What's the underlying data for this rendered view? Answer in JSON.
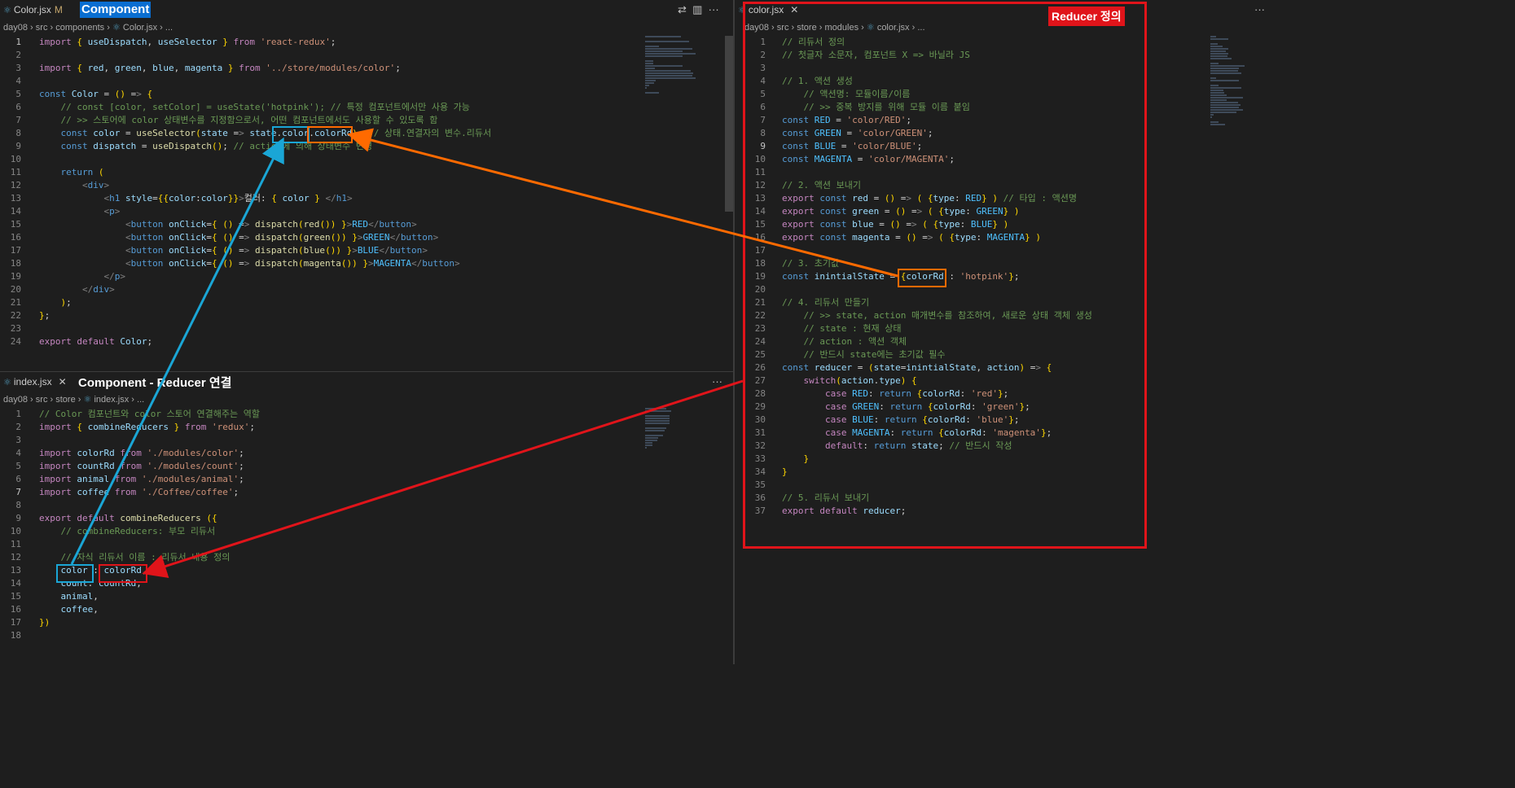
{
  "left_top": {
    "tabs": [
      {
        "label": "Color.jsx",
        "modified": "M",
        "icon": "react-icon"
      },
      {
        "label": "Component",
        "highlighted": true
      }
    ],
    "breadcrumb": [
      "day08",
      "src",
      "components",
      "Color.jsx",
      "..."
    ],
    "lines": [
      "import { useDispatch, useSelector } from 'react-redux';",
      "",
      "import { red, green, blue, magenta } from '../store/modules/color';",
      "",
      "const Color = () => {",
      "    // const [color, setColor] = useState('hotpink'); // 특정 컴포넌트에서만 사용 가능",
      "    // >> 스토어에 color 상태변수를 지정함으로서, 어떤 컴포넌트에서도 사용할 수 있도록 함",
      "    const color = useSelector(state => state.color.colorRd); // 상태.연결자의 변수.리듀서",
      "    const dispatch = useDispatch(); // action에 의해 상태변수 변경",
      "",
      "    return (",
      "        <div>",
      "            <h1 style={{color:color}}>컬러: { color } </h1>",
      "            <p>",
      "                <button onClick={ () => dispatch(red()) }>RED</button>",
      "                <button onClick={ () => dispatch(green()) }>GREEN</button>",
      "                <button onClick={ () => dispatch(blue()) }>BLUE</button>",
      "                <button onClick={ () => dispatch(magenta()) }>MAGENTA</button>",
      "            </p>",
      "        </div>",
      "    );",
      "};",
      "",
      "export default Color;"
    ]
  },
  "left_bottom": {
    "tab": "index.jsx",
    "title": "Component - Reducer 연결",
    "breadcrumb": [
      "day08",
      "src",
      "store",
      "index.jsx",
      "..."
    ],
    "lines": [
      "// Color 컴포넌트와 color 스토어 연결해주는 역할",
      "import { combineReducers } from 'redux';",
      "",
      "import colorRd from './modules/color';",
      "import countRd from './modules/count';",
      "import animal from './modules/animal';",
      "import coffee from './Coffee/coffee';",
      "",
      "export default combineReducers ({",
      "    // combineReducers: 부모 리듀서",
      "",
      "    // 자식 리듀서 이름 : 리듀서 내용 정의",
      "    color : colorRd,",
      "    count: countRd,",
      "    animal,",
      "    coffee,",
      "})",
      ""
    ]
  },
  "right": {
    "tab": "color.jsx",
    "title": "Reducer 정의",
    "breadcrumb": [
      "day08",
      "src",
      "store",
      "modules",
      "color.jsx",
      "..."
    ],
    "lines": [
      "// 리듀서 정의",
      "// 첫글자 소문자, 컴포넌트 X => 바닐라 JS",
      "",
      "// 1. 액션 생성",
      "    // 액션명: 모듈이름/이름",
      "    // >> 중복 방지를 위해 모듈 이름 붙임",
      "const RED = 'color/RED';",
      "const GREEN = 'color/GREEN';",
      "const BLUE = 'color/BLUE';",
      "const MAGENTA = 'color/MAGENTA';",
      "",
      "// 2. 액션 보내기",
      "export const red = () => ( {type: RED} ) // 타입 : 액션명",
      "export const green = () => ( {type: GREEN} )",
      "export const blue = () => ( {type: BLUE} )",
      "export const magenta = () => ( {type: MAGENTA} )",
      "",
      "// 3. 초기값",
      "const inintialState = {colorRd : 'hotpink'};",
      "",
      "// 4. 리듀서 만들기",
      "    // >> state, action 매개변수를 참조하여, 새로운 상태 객체 생성",
      "    // state : 현재 상태",
      "    // action : 액션 객체",
      "    // 반드시 state에는 초기값 필수",
      "const reducer = (state=inintialState, action) => {",
      "    switch(action.type) {",
      "        case RED: return {colorRd: 'red'};",
      "        case GREEN: return {colorRd: 'green'};",
      "        case BLUE: return {colorRd: 'blue'};",
      "        case MAGENTA: return {colorRd: 'magenta'};",
      "        default: return state; // 반드시 작성",
      "    }",
      "}",
      "",
      "// 5. 리듀서 보내기",
      "export default reducer;"
    ]
  },
  "colors": {
    "orange": "#ff6a00",
    "blue": "#1aa6d6",
    "red": "#e0141a"
  }
}
